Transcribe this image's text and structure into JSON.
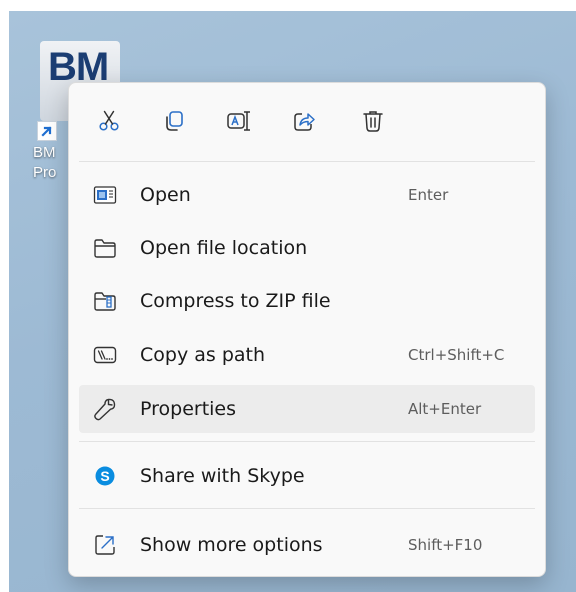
{
  "desktop": {
    "shortcut": {
      "logo_text": "BM",
      "label_line1": "BM",
      "label_line2": "Pro"
    }
  },
  "context_menu": {
    "toolbar": [
      {
        "name": "cut-button",
        "icon": "scissors-icon",
        "label": "Cut"
      },
      {
        "name": "copy-button",
        "icon": "copy-icon",
        "label": "Copy"
      },
      {
        "name": "rename-button",
        "icon": "rename-icon",
        "label": "Rename"
      },
      {
        "name": "share-button",
        "icon": "share-icon",
        "label": "Share"
      },
      {
        "name": "delete-button",
        "icon": "trash-icon",
        "label": "Delete"
      }
    ],
    "items": [
      {
        "label": "Open",
        "shortcut": "Enter",
        "icon": "open-app-icon"
      },
      {
        "label": "Open file location",
        "shortcut": "",
        "icon": "folder-icon"
      },
      {
        "label": "Compress to ZIP file",
        "shortcut": "",
        "icon": "zip-folder-icon"
      },
      {
        "label": "Copy as path",
        "shortcut": "Ctrl+Shift+C",
        "icon": "path-icon"
      },
      {
        "label": "Properties",
        "shortcut": "Alt+Enter",
        "icon": "wrench-icon",
        "highlighted": true
      },
      {
        "label": "Share with Skype",
        "shortcut": "",
        "icon": "skype-icon"
      },
      {
        "label": "Show more options",
        "shortcut": "Shift+F10",
        "icon": "more-options-icon"
      }
    ]
  },
  "colors": {
    "menu_background": "#f9f9f9",
    "hover_background": "#ececec",
    "desktop_background": "#9dbad4",
    "skype_blue": "#0a8de0",
    "accent_blue": "#2b6fc7"
  }
}
